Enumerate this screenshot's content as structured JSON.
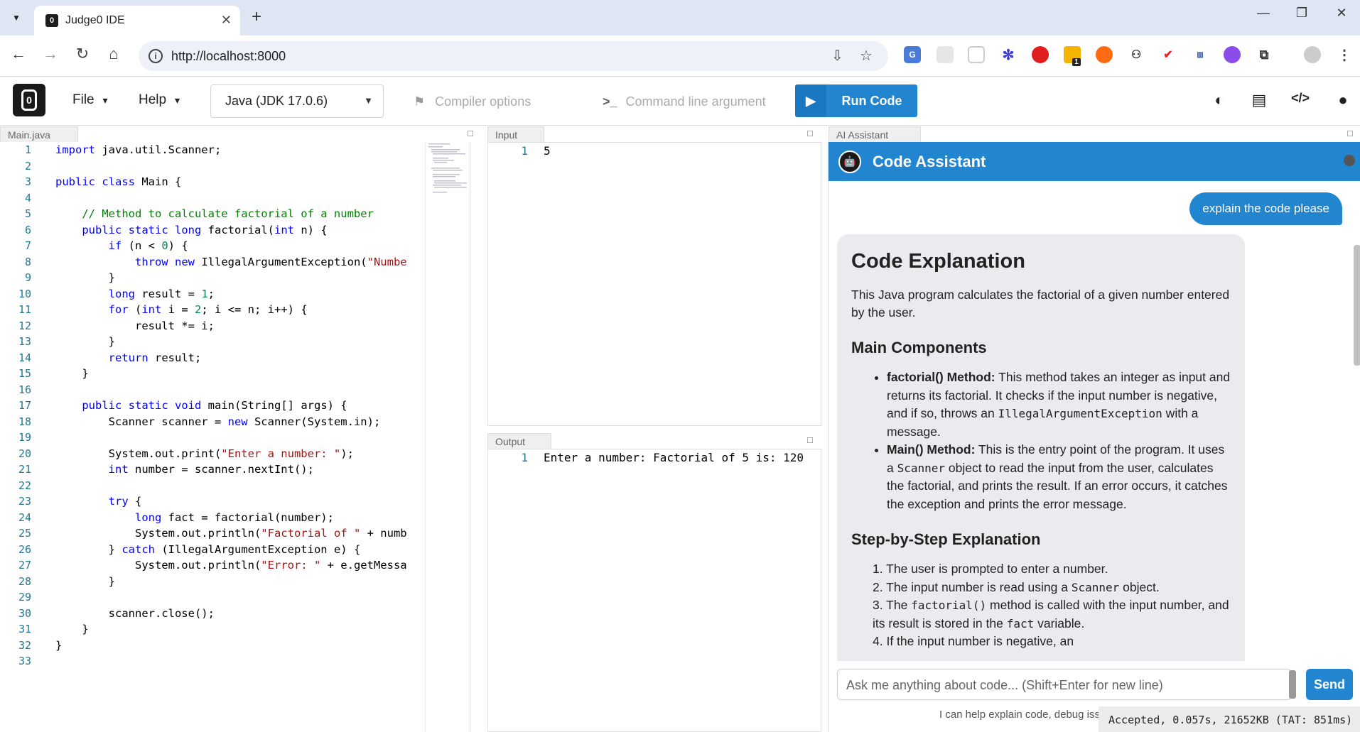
{
  "browser": {
    "tab_title": "Judge0 IDE",
    "tab_favicon": "0",
    "url": "http://localhost:8000",
    "ext_badge": "1"
  },
  "app": {
    "logo": "0",
    "menus": [
      "File",
      "Help"
    ],
    "language": "Java (JDK 17.0.6)",
    "compiler_options": "Compiler options",
    "command_line_args": "Command line arguments",
    "run_button": "Run Code"
  },
  "editor": {
    "tab": "Main.java",
    "line_numbers": [
      "1",
      "2",
      "3",
      "4",
      "5",
      "6",
      "7",
      "8",
      "9",
      "10",
      "11",
      "12",
      "13",
      "14",
      "15",
      "16",
      "17",
      "18",
      "19",
      "20",
      "21",
      "22",
      "23",
      "24",
      "25",
      "26",
      "27",
      "28",
      "29",
      "30",
      "31",
      "32",
      "33"
    ]
  },
  "input": {
    "tab": "Input",
    "line": "1",
    "text": "5"
  },
  "output": {
    "tab": "Output",
    "line": "1",
    "text": "Enter a number: Factorial of 5 is: 120"
  },
  "ai": {
    "tab": "AI Assistant",
    "title": "Code Assistant",
    "user_message": "explain the code please",
    "heading": "Code Explanation",
    "intro": "This Java program calculates the factorial of a given number entered by the user.",
    "h_components": "Main Components",
    "c1_bold": "factorial() Method:",
    "c1_a": " This method takes an integer as input and returns its factorial. It checks if the input number is negative, and if so, throws an ",
    "c1_code": "IllegalArgumentException",
    "c1_b": " with a message.",
    "c2_bold": "Main() Method:",
    "c2_a": " This is the entry point of the program. It uses a ",
    "c2_code": "Scanner",
    "c2_b": " object to read the input from the user, calculates the factorial, and prints the result. If an error occurs, it catches the exception and prints the error message.",
    "h_steps": "Step-by-Step Explanation",
    "s1": "1. The user is prompted to enter a number.",
    "s2_a": "2. The input number is read using a ",
    "s2_code": "Scanner",
    "s2_b": " object.",
    "s3_a": "3. The ",
    "s3_code": "factorial()",
    "s3_b": " method is called with the input number, and its result is stored in the ",
    "s3_code2": "fact",
    "s3_c": " variable.",
    "s4": "4. If the input number is negative, an",
    "input_placeholder": "Ask me anything about code... (Shift+Enter for new line)",
    "send": "Send",
    "hint": "I can help explain code, debug issues"
  },
  "status": "Accepted, 0.057s, 21652KB (TAT: 851ms)",
  "colors": {
    "accent": "#2185d0",
    "tabstrip": "#dee6f4"
  }
}
